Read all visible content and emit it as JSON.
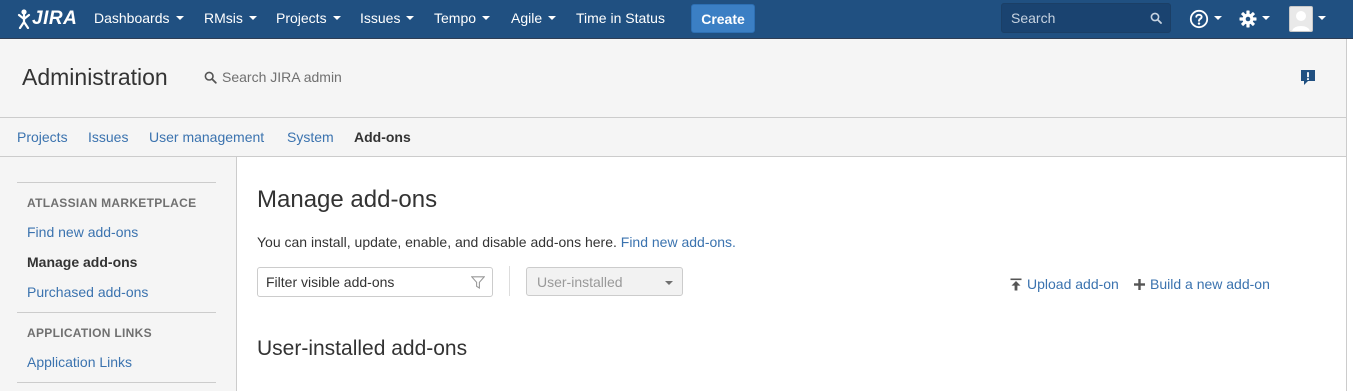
{
  "header": {
    "logo_text": "JIRA",
    "nav": [
      {
        "label": "Dashboards",
        "dropdown": true
      },
      {
        "label": "RMsis",
        "dropdown": true
      },
      {
        "label": "Projects",
        "dropdown": true
      },
      {
        "label": "Issues",
        "dropdown": true
      },
      {
        "label": "Tempo",
        "dropdown": true
      },
      {
        "label": "Agile",
        "dropdown": true
      },
      {
        "label": "Time in Status",
        "dropdown": false
      }
    ],
    "create_label": "Create",
    "search_placeholder": "Search",
    "icons": {
      "help": "help-icon",
      "settings": "gear-icon",
      "profile": "avatar"
    },
    "colors": {
      "header_bg": "#205081",
      "create_bg": "#3b7fc4"
    }
  },
  "admin": {
    "title": "Administration",
    "search_placeholder": "Search JIRA admin",
    "feedback_icon": "feedback-icon"
  },
  "admin_tabs": [
    {
      "label": "Projects",
      "active": false
    },
    {
      "label": "Issues",
      "active": false
    },
    {
      "label": "User management",
      "active": false
    },
    {
      "label": "System",
      "active": false
    },
    {
      "label": "Add-ons",
      "active": true
    }
  ],
  "sidebar": {
    "sections": [
      {
        "heading": "ATLASSIAN MARKETPLACE",
        "items": [
          {
            "label": "Find new add-ons",
            "current": false
          },
          {
            "label": "Manage add-ons",
            "current": true
          },
          {
            "label": "Purchased add-ons",
            "current": false
          }
        ]
      },
      {
        "heading": "APPLICATION LINKS",
        "items": [
          {
            "label": "Application Links",
            "current": false
          }
        ]
      }
    ]
  },
  "main": {
    "title": "Manage add-ons",
    "intro_text": "You can install, update, enable, and disable add-ons here.",
    "intro_link": "Find new add-ons.",
    "filter_placeholder": "Filter visible add-ons",
    "select_value": "User-installed",
    "upload_label": "Upload add-on",
    "build_label": "Build a new add-on",
    "section_title": "User-installed add-ons",
    "link_color": "#3b73af"
  }
}
